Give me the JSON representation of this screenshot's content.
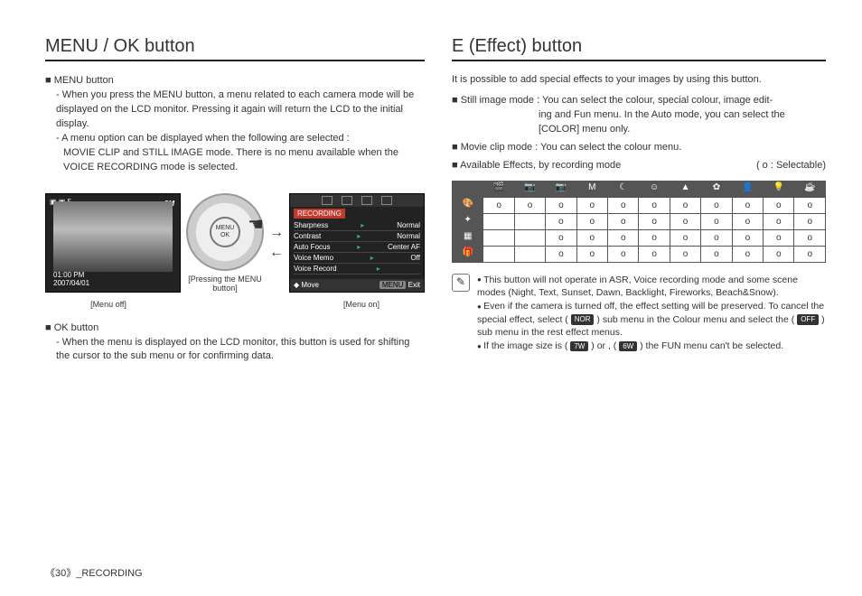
{
  "left": {
    "title": "MENU / OK button",
    "menu_heading": "MENU button",
    "menu_p1": "When you press the MENU button, a menu related to each camera mode will be displayed on the LCD monitor. Pressing it again will return the LCD to the initial display.",
    "menu_p2a": "A menu option can be displayed when the following are selected :",
    "menu_p2b": "MOVIE CLIP and STILL IMAGE mode. There is no menu available when the VOICE RECORDING mode is selected.",
    "fig": {
      "lcd1_corner": "▣ ▣ 5",
      "lcd1_r": "8M",
      "lcd1_time": "01:00 PM",
      "lcd1_date": "2007/04/01",
      "dial_center1": "MENU",
      "dial_center2": "OK",
      "press_caption": "[Pressing the MENU button]",
      "menu_title": "RECORDING",
      "rows": [
        {
          "l": "Sharpness",
          "r": "Normal"
        },
        {
          "l": "Contrast",
          "r": "Normal"
        },
        {
          "l": "Auto Focus",
          "r": "Center AF"
        },
        {
          "l": "Voice Memo",
          "r": "Off"
        },
        {
          "l": "Voice Record",
          "r": ""
        }
      ],
      "foot_move": "Move",
      "foot_menu": "MENU",
      "foot_exit": "Exit",
      "cap_off": "[Menu off]",
      "cap_on": "[Menu on]"
    },
    "ok_heading": "OK button",
    "ok_p": "When the menu is displayed on the LCD monitor, this button is used for shifting the cursor to the sub menu or for confirming data."
  },
  "right": {
    "title": "E (Effect) button",
    "intro": "It is possible to add special effects to your images by using this button.",
    "still_a": "Still image mode : You can select the colour, special colour, image edit-",
    "still_b": "ing and Fun menu. In the Auto mode, you can  select the [COLOR] menu only.",
    "movie": "Movie clip mode : You can select the colour menu.",
    "avail": "Available Effects, by recording mode",
    "legend": "( o : Selectable)",
    "col_icons": [
      "movie",
      "camera",
      "camera-p",
      "M",
      "night",
      "portrait",
      "mountain",
      "flower",
      "person",
      "bulb",
      "cup"
    ],
    "row_icons": [
      "palette",
      "sparkle",
      "image-adj",
      "gift"
    ],
    "grid": [
      [
        1,
        1,
        1,
        1,
        1,
        1,
        1,
        1,
        1,
        1,
        1
      ],
      [
        0,
        0,
        1,
        1,
        1,
        1,
        1,
        1,
        1,
        1,
        1
      ],
      [
        0,
        0,
        1,
        1,
        1,
        1,
        1,
        1,
        1,
        1,
        1
      ],
      [
        0,
        0,
        1,
        1,
        1,
        1,
        1,
        1,
        1,
        1,
        1
      ]
    ],
    "note1": "This button will not operate in ASR, Voice recording mode and some scene modes (Night, Text, Sunset, Dawn, Backlight, Fireworks, Beach&Snow).",
    "note2a": "Even if the camera is turned off, the effect setting will be preserved. To cancel the special effect, select (",
    "note2_tag1": "NOR",
    "note2b": ") sub menu in the Colour menu and select the (",
    "note2_tag2": "OFF",
    "note2c": ") sub menu in the rest effect menus.",
    "note3a": "If the image size is (",
    "note3_tag1": "7W",
    "note3b": ") or , (",
    "note3_tag2": "6W",
    "note3c": ") the FUN menu can't be selected."
  },
  "footer": {
    "page": "30",
    "section": "_RECORDING"
  }
}
